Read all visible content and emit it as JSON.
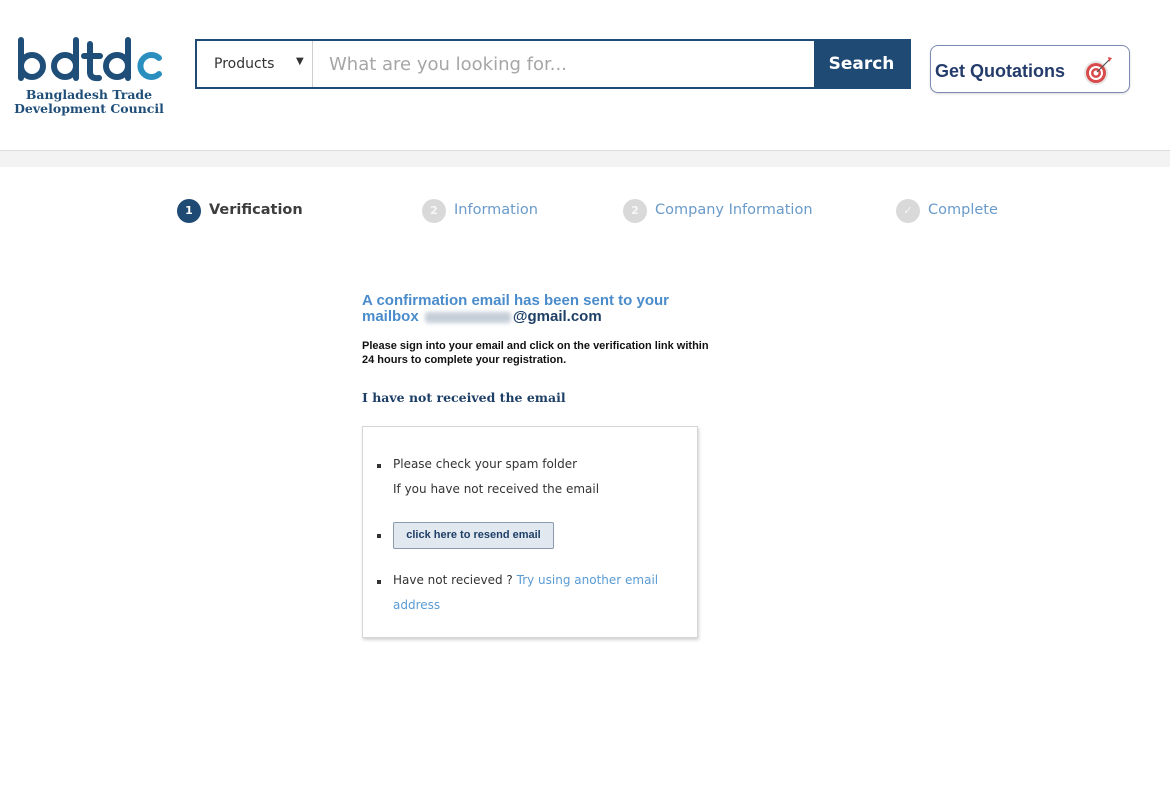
{
  "header": {
    "logo_text_line1": "Bangladesh Trade",
    "logo_text_line2": "Development Council",
    "search": {
      "category": "Products",
      "placeholder": "What are you looking for...",
      "button_label": "Search"
    },
    "quotations_label": "Get Quotations"
  },
  "steps": [
    {
      "number": "1",
      "label": "Verification",
      "state": "active"
    },
    {
      "number": "2",
      "label": "Information",
      "state": "inactive"
    },
    {
      "number": "2",
      "label": "Company Information",
      "state": "inactive"
    },
    {
      "number": "✓",
      "label": "Complete",
      "state": "inactive"
    }
  ],
  "main": {
    "confirmation_line1": "A confirmation email has been sent to your",
    "confirmation_mailbox": "mailbox",
    "email_domain": "@gmail.com",
    "instructions": "Please sign into your email and click on the verification link within 24 hours to complete your registration.",
    "not_received_heading": "I have not received the email",
    "help": {
      "spam_line": "Please check your spam folder",
      "spam_sub": "If you have not received the email",
      "resend_button": "click here to resend email",
      "not_recieved_text": "Have not recieved ?",
      "try_link_line1": "Try using another email",
      "try_link_line2": "address"
    }
  },
  "colors": {
    "brand_navy": "#1e4a74",
    "link_blue": "#5a9bd4",
    "title_blue": "#4a8ccb"
  }
}
